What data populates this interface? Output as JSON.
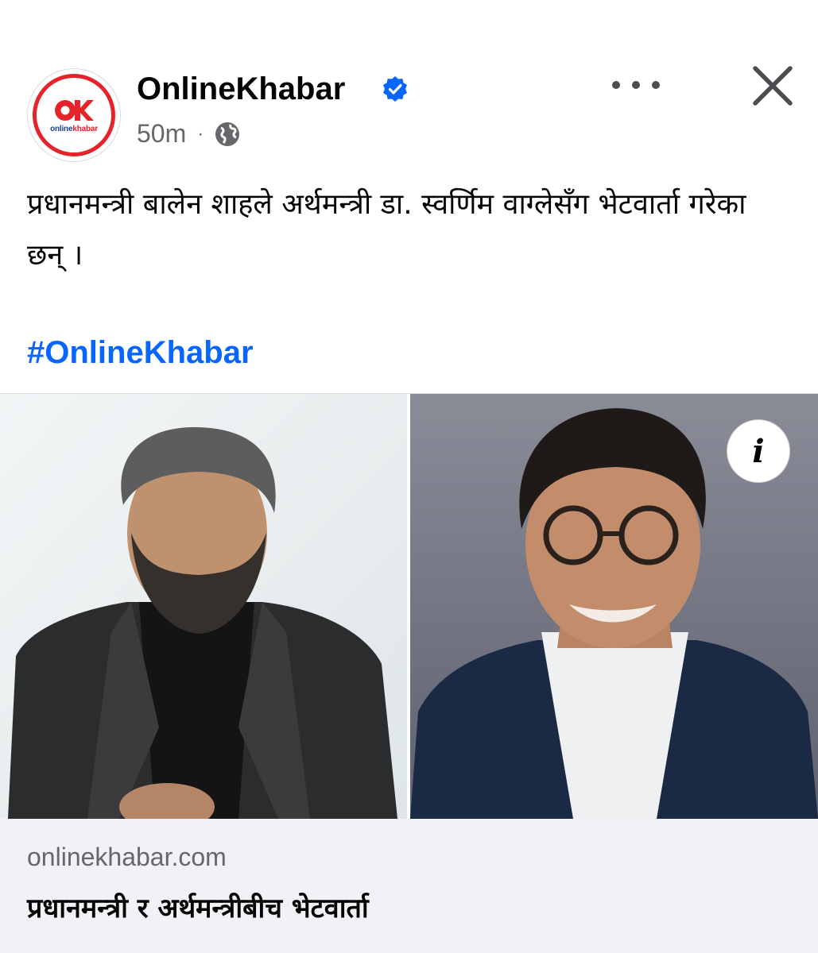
{
  "post": {
    "page_name": "OnlineKhabar",
    "logo_text_a": "online",
    "logo_text_b": "khabar",
    "timestamp": "50m",
    "separator": "·",
    "audience_icon": "globe-icon",
    "verified_icon": "verified-badge-icon",
    "text": "प्रधानमन्त्री बालेन शाहले अर्थमन्त्री डा. स्वर्णिम वाग्लेसँग भेटवार्ता गरेका छन् ।",
    "hashtag": "#OnlineKhabar"
  },
  "media": {
    "info_label": "i"
  },
  "link": {
    "domain": "onlinekhabar.com",
    "title": "प्रधानमन्त्री र अर्थमन्त्रीबीच भेटवार्ता"
  },
  "colors": {
    "brand_red": "#e6232a",
    "brand_blue": "#1d3f8f",
    "link_blue": "#0866ff",
    "secondary_text": "#65676b"
  }
}
